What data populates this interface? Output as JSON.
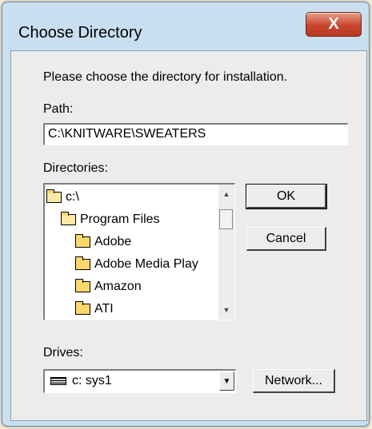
{
  "window": {
    "title": "Choose Directory",
    "close_icon": "close-x-icon",
    "close_glyph": "X"
  },
  "prompt": "Please choose the directory for installation.",
  "path": {
    "label": "Path:",
    "value": "C:\\KNITWARE\\SWEATERS"
  },
  "directories": {
    "label": "Directories:",
    "items": [
      {
        "label": "c:\\",
        "icon": "open-folder-icon"
      },
      {
        "label": "Program Files",
        "icon": "open-folder-icon"
      },
      {
        "label": "Adobe",
        "icon": "folder-icon"
      },
      {
        "label": "Adobe Media Play",
        "icon": "folder-icon"
      },
      {
        "label": "Amazon",
        "icon": "folder-icon"
      },
      {
        "label": "ATI",
        "icon": "folder-icon"
      }
    ]
  },
  "buttons": {
    "ok": "OK",
    "cancel": "Cancel",
    "network": "Network..."
  },
  "drives": {
    "label": "Drives:",
    "selected": "c: sys1",
    "icon": "drive-icon"
  },
  "colors": {
    "frame": "#c9dff0",
    "close_button": "#c9452c",
    "dialog_background": "#ececec"
  }
}
